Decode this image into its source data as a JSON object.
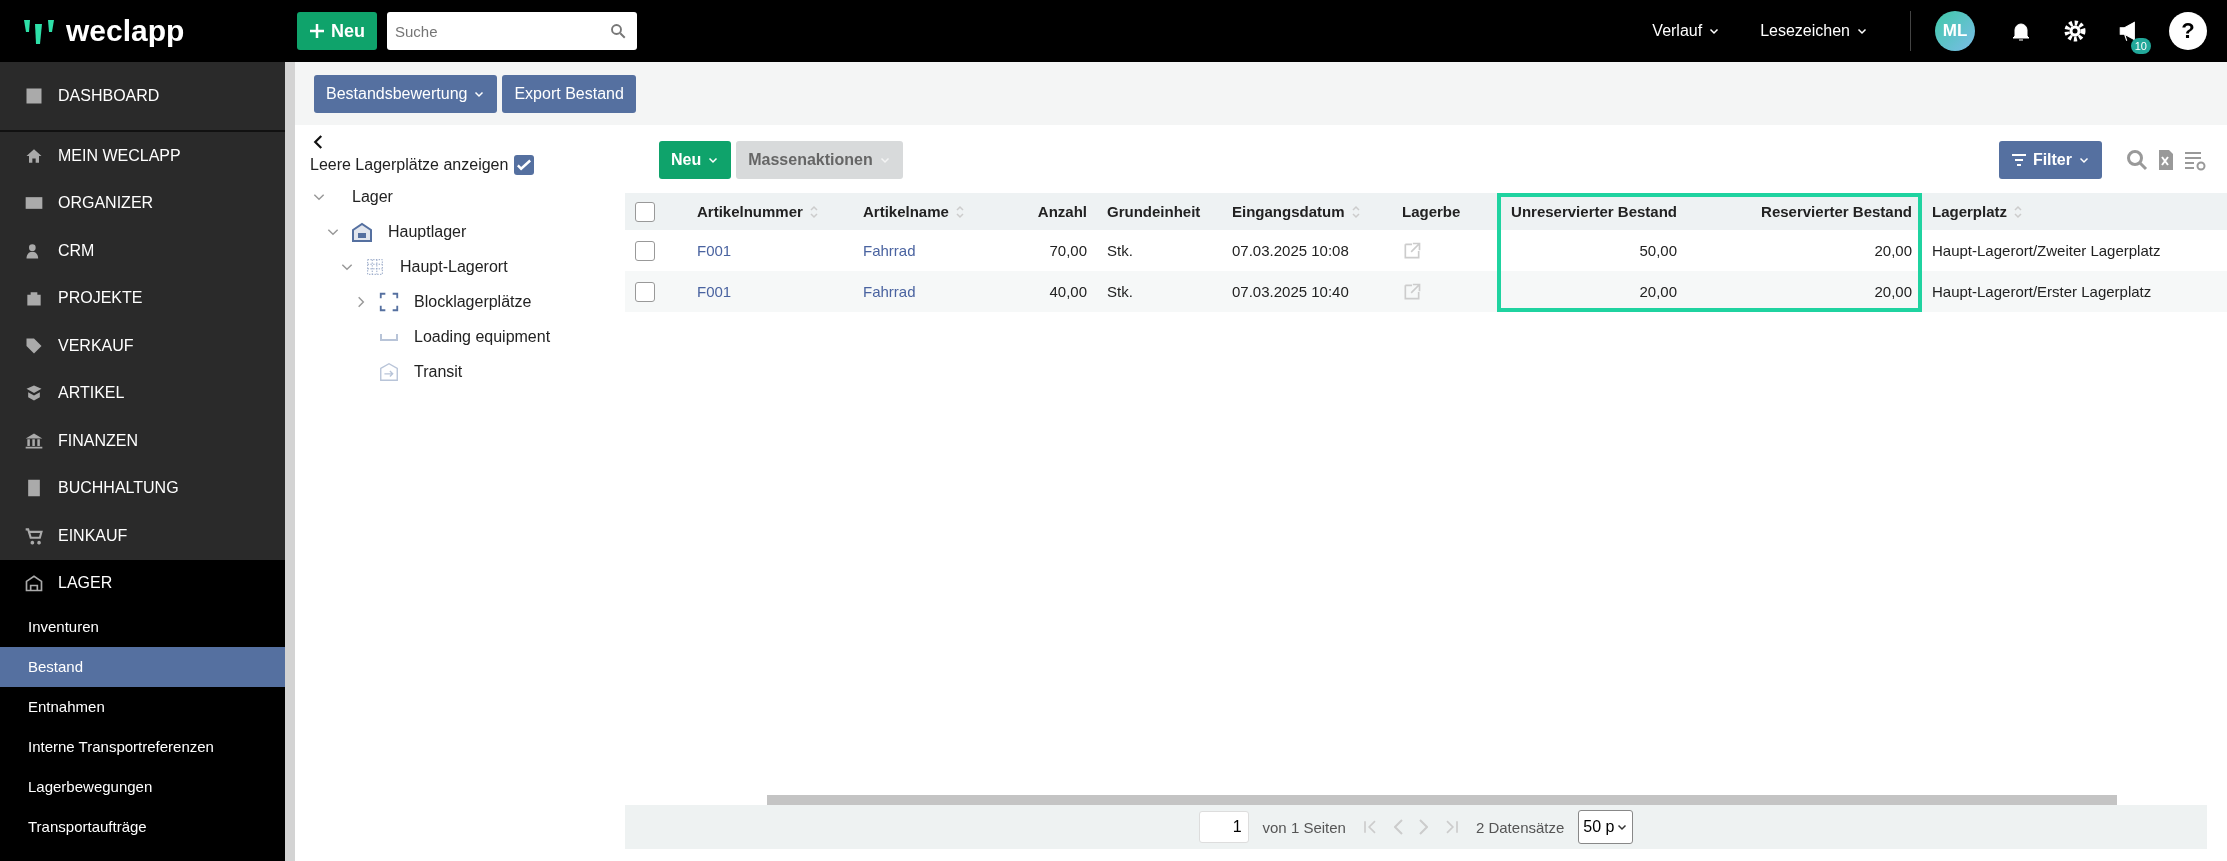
{
  "topbar": {
    "logo": "weclapp",
    "new_button": "Neu",
    "search": {
      "placeholder": "Suche"
    },
    "menus": [
      "Verlauf",
      "Lesezeichen"
    ],
    "avatar": "ML",
    "notification_badge": "10",
    "help": "?"
  },
  "sidebar": {
    "items": [
      {
        "label": "DASHBOARD",
        "kind": "section",
        "selected": false
      },
      {
        "label": "MEIN WECLAPP",
        "kind": "section",
        "selected": false
      },
      {
        "label": "ORGANIZER",
        "kind": "section",
        "selected": false
      },
      {
        "label": "CRM",
        "kind": "section",
        "selected": false
      },
      {
        "label": "PROJEKTE",
        "kind": "section",
        "selected": false
      },
      {
        "label": "VERKAUF",
        "kind": "section",
        "selected": false
      },
      {
        "label": "ARTIKEL",
        "kind": "section",
        "selected": false
      },
      {
        "label": "FINANZEN",
        "kind": "section",
        "selected": false
      },
      {
        "label": "BUCHHALTUNG",
        "kind": "section",
        "selected": false
      },
      {
        "label": "EINKAUF",
        "kind": "section",
        "selected": false
      },
      {
        "label": "LAGER",
        "kind": "open-section",
        "selected": false
      },
      {
        "label": "Inventuren",
        "kind": "sub",
        "selected": false
      },
      {
        "label": "Bestand",
        "kind": "sub",
        "selected": true
      },
      {
        "label": "Entnahmen",
        "kind": "sub",
        "selected": false
      },
      {
        "label": "Interne Transportreferenzen",
        "kind": "sub",
        "selected": false
      },
      {
        "label": "Lagerbewegungen",
        "kind": "sub",
        "selected": false
      },
      {
        "label": "Transportaufträge",
        "kind": "sub",
        "selected": false
      }
    ]
  },
  "actions": [
    {
      "label": "Bestandsbewertung",
      "dropdown": true
    },
    {
      "label": "Export Bestand",
      "dropdown": false
    }
  ],
  "tree_panel": {
    "show_empty": {
      "label": "Leere Lagerplätze anzeigen",
      "checked": true
    },
    "tree": [
      {
        "label": "Lager",
        "kind": "root",
        "expanded": true,
        "children": [
          {
            "label": "Hauptlager",
            "kind": "warehouse",
            "expanded": true,
            "children": [
              {
                "label": "Haupt-Lagerort",
                "kind": "area",
                "expanded": true,
                "children": [
                  {
                    "label": "Blocklagerplätze",
                    "kind": "block",
                    "expanded": false
                  },
                  {
                    "label": "Loading equipment",
                    "kind": "equipment"
                  },
                  {
                    "label": "Transit",
                    "kind": "transit"
                  }
                ]
              }
            ]
          }
        ]
      }
    ]
  },
  "table_toolbar": {
    "new_button": "Neu",
    "bulk_button": {
      "label": "Massenaktionen",
      "disabled": true
    },
    "filter_button": "Filter"
  },
  "table": {
    "columns": [
      {
        "label": "Artikelnummer",
        "sortable": true,
        "kind": "link",
        "highlighted": false
      },
      {
        "label": "Artikelname",
        "sortable": true,
        "kind": "link",
        "highlighted": false
      },
      {
        "label": "Anzahl",
        "sortable": false,
        "kind": "number",
        "highlighted": false
      },
      {
        "label": "Grundeinheit",
        "sortable": false,
        "kind": "text",
        "highlighted": false
      },
      {
        "label": "Eingangsdatum",
        "sortable": true,
        "kind": "text",
        "highlighted": false
      },
      {
        "label": "Lagerbe",
        "sortable": false,
        "kind": "icon",
        "highlighted": false
      },
      {
        "label": "Unreservierter Bestand",
        "sortable": false,
        "kind": "number",
        "highlighted": true
      },
      {
        "label": "Reservierter Bestand",
        "sortable": false,
        "kind": "number",
        "highlighted": true
      },
      {
        "label": "Lagerplatz",
        "sortable": true,
        "kind": "text",
        "highlighted": false
      }
    ],
    "all_selected": false,
    "rows": [
      {
        "checked": false,
        "cells": [
          "F001",
          "Fahrrad",
          "70,00",
          "Stk.",
          "07.03.2025 10:08",
          "",
          "50,00",
          "20,00",
          "Haupt-Lagerort/Zweiter Lagerplatz"
        ]
      },
      {
        "checked": false,
        "cells": [
          "F001",
          "Fahrrad",
          "40,00",
          "Stk.",
          "07.03.2025 10:40",
          "",
          "20,00",
          "20,00",
          "Haupt-Lagerort/Erster Lagerplatz"
        ]
      }
    ]
  },
  "pagination": {
    "page": "1",
    "of_pages": "von 1 Seiten",
    "records": "2 Datensätze",
    "page_size": "50 p"
  }
}
